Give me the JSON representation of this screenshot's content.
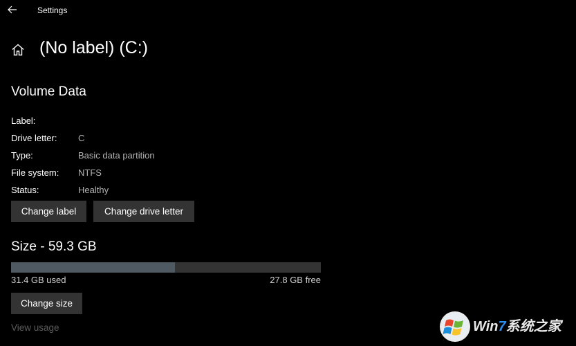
{
  "app": {
    "title": "Settings"
  },
  "header": {
    "page_title": "(No label) (C:)"
  },
  "volume": {
    "section_title": "Volume Data",
    "properties": [
      {
        "label": "Label:",
        "value": ""
      },
      {
        "label": "Drive letter:",
        "value": "C"
      },
      {
        "label": "Type:",
        "value": "Basic data partition"
      },
      {
        "label": "File system:",
        "value": "NTFS"
      },
      {
        "label": "Status:",
        "value": "Healthy"
      }
    ],
    "change_label_button": "Change label",
    "change_drive_letter_button": "Change drive letter"
  },
  "size": {
    "section_title": "Size - 59.3 GB",
    "used_text": "31.4 GB used",
    "free_text": "27.8 GB free",
    "used_fraction": 0.53,
    "change_size_button": "Change size",
    "view_usage_link": "View usage"
  },
  "colors": {
    "background": "#000000",
    "button_bg": "#333333",
    "bar_track": "#333333",
    "bar_fill": "#4f5961",
    "secondary_text": "#b3b3b3",
    "disabled_link": "#5c5c5c"
  },
  "watermark": {
    "prefix": "Win",
    "seven": "7",
    "suffix": "系统之家"
  },
  "icons": {
    "back": "back-arrow-icon",
    "home": "home-icon",
    "watermark_logo": "windows-flag-logo"
  }
}
